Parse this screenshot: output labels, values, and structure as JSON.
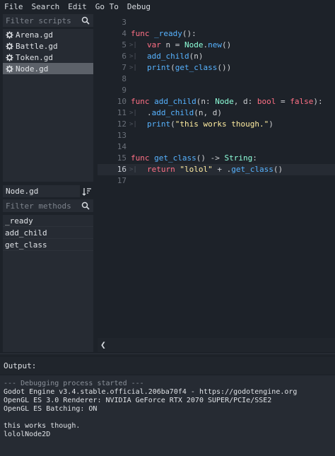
{
  "menu": [
    "File",
    "Search",
    "Edit",
    "Go To",
    "Debug"
  ],
  "scripts_filter": {
    "placeholder": "Filter scripts"
  },
  "scripts": [
    {
      "name": "Arena.gd",
      "selected": false
    },
    {
      "name": "Battle.gd",
      "selected": false
    },
    {
      "name": "Token.gd",
      "selected": false
    },
    {
      "name": "Node.gd",
      "selected": true
    }
  ],
  "current_file": "Node.gd",
  "methods_filter": {
    "placeholder": "Filter methods"
  },
  "methods": [
    "_ready",
    "add_child",
    "get_class"
  ],
  "editor": {
    "current_line": 16,
    "lines": [
      {
        "n": "3",
        "tokens": []
      },
      {
        "n": "4",
        "tokens": [
          [
            "kw",
            "func "
          ],
          [
            "fn",
            "_ready"
          ],
          [
            "pl",
            "():"
          ]
        ]
      },
      {
        "n": "5",
        "fold": true,
        "tokens": [
          [
            "kw",
            "var "
          ],
          [
            "pl",
            "n = "
          ],
          [
            "typ",
            "Node"
          ],
          [
            "pl",
            "."
          ],
          [
            "fn",
            "new"
          ],
          [
            "pl",
            "()"
          ]
        ]
      },
      {
        "n": "6",
        "fold": true,
        "tokens": [
          [
            "fn",
            "add_child"
          ],
          [
            "pl",
            "(n)"
          ]
        ]
      },
      {
        "n": "7",
        "fold": true,
        "tokens": [
          [
            "fn",
            "print"
          ],
          [
            "pl",
            "("
          ],
          [
            "fn",
            "get_class"
          ],
          [
            "pl",
            "())"
          ]
        ]
      },
      {
        "n": "8",
        "tokens": []
      },
      {
        "n": "9",
        "tokens": []
      },
      {
        "n": "10",
        "tokens": [
          [
            "kw",
            "func "
          ],
          [
            "fn",
            "add_child"
          ],
          [
            "pl",
            "(n: "
          ],
          [
            "typ",
            "Node"
          ],
          [
            "pl",
            ", d: "
          ],
          [
            "kw",
            "bool"
          ],
          [
            "pl",
            " = "
          ],
          [
            "kw",
            "false"
          ],
          [
            "pl",
            "):"
          ]
        ]
      },
      {
        "n": "11",
        "fold": true,
        "tokens": [
          [
            "pl",
            "."
          ],
          [
            "fn",
            "add_child"
          ],
          [
            "pl",
            "(n, d)"
          ]
        ]
      },
      {
        "n": "12",
        "fold": true,
        "tokens": [
          [
            "fn",
            "print"
          ],
          [
            "pl",
            "("
          ],
          [
            "str",
            "\"this works though.\""
          ],
          [
            "pl",
            ")"
          ]
        ]
      },
      {
        "n": "13",
        "tokens": []
      },
      {
        "n": "14",
        "tokens": []
      },
      {
        "n": "15",
        "tokens": [
          [
            "kw",
            "func "
          ],
          [
            "fn",
            "get_class"
          ],
          [
            "pl",
            "() -> "
          ],
          [
            "typ",
            "String"
          ],
          [
            "pl",
            ":"
          ]
        ]
      },
      {
        "n": "16",
        "fold": true,
        "tokens": [
          [
            "kw",
            "return "
          ],
          [
            "str",
            "\"lolol\""
          ],
          [
            "pl",
            " + ."
          ],
          [
            "fn",
            "get_class"
          ],
          [
            "pl",
            "()"
          ]
        ]
      },
      {
        "n": "17",
        "tokens": []
      }
    ]
  },
  "output": {
    "label": "Output:",
    "lines": [
      {
        "text": "--- Debugging process started ---",
        "dim": true
      },
      {
        "text": "Godot Engine v3.4.stable.official.206ba70f4 - https://godotengine.org"
      },
      {
        "text": "OpenGL ES 3.0 Renderer: NVIDIA GeForce RTX 2070 SUPER/PCIe/SSE2"
      },
      {
        "text": "OpenGL ES Batching: ON"
      },
      {
        "text": ""
      },
      {
        "text": "this works though."
      },
      {
        "text": "lololNode2D"
      }
    ]
  }
}
